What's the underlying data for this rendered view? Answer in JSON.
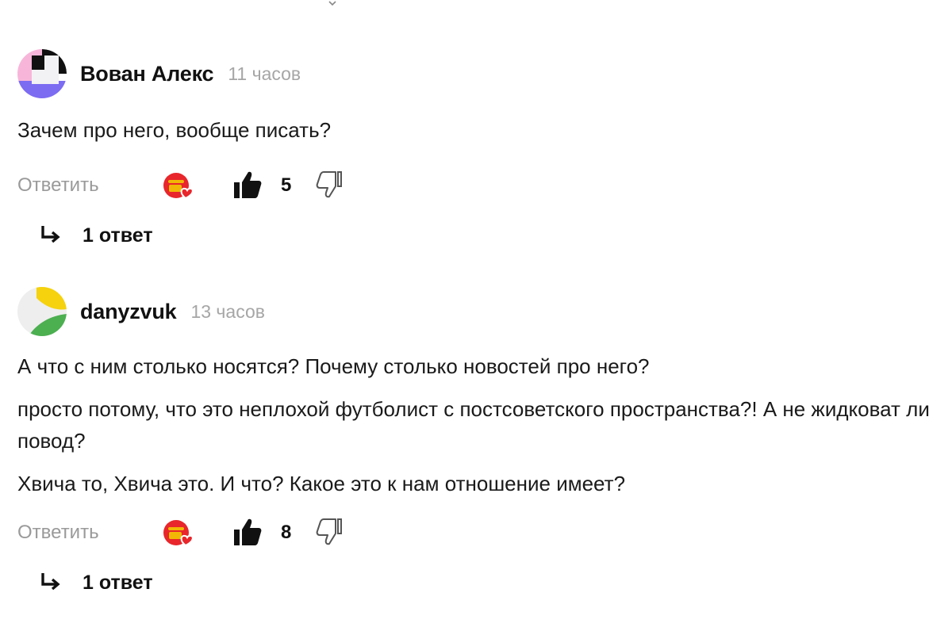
{
  "comments": [
    {
      "author": "Вован Алекс",
      "time": "11 часов",
      "paragraphs": [
        "Зачем про него, вообще писать?"
      ],
      "reply_label": "Ответить",
      "likes": "5",
      "replies_label": "1 ответ",
      "avatar_colors": [
        "#f7b6d9",
        "#111111",
        "#7b6cf2",
        "#ffffff"
      ]
    },
    {
      "author": "danyzvuk",
      "time": "13 часов",
      "paragraphs": [
        "А что с ним столько носятся? Почему столько новостей про него?",
        "просто потому, что это неплохой футболист с постсоветского пространства?! А не жидковат ли повод?",
        "Хвича то, Хвича это. И что? Какое это к нам отношение имеет?"
      ],
      "reply_label": "Ответить",
      "likes": "8",
      "replies_label": "1 ответ",
      "avatar_colors": [
        "#f5d20d",
        "#4caf50",
        "#eeeeee"
      ]
    }
  ],
  "icons": {
    "top": "chevron-down-icon",
    "emoji": "emoji-reaction-icon",
    "like": "thumbs-up-icon",
    "dislike": "thumbs-down-icon",
    "replies": "reply-arrow-icon"
  },
  "colors": {
    "muted_text": "#9a9a9a",
    "time_text": "#a6a6a6",
    "emoji_red": "#e8262b",
    "emoji_gold": "#f2b705"
  }
}
